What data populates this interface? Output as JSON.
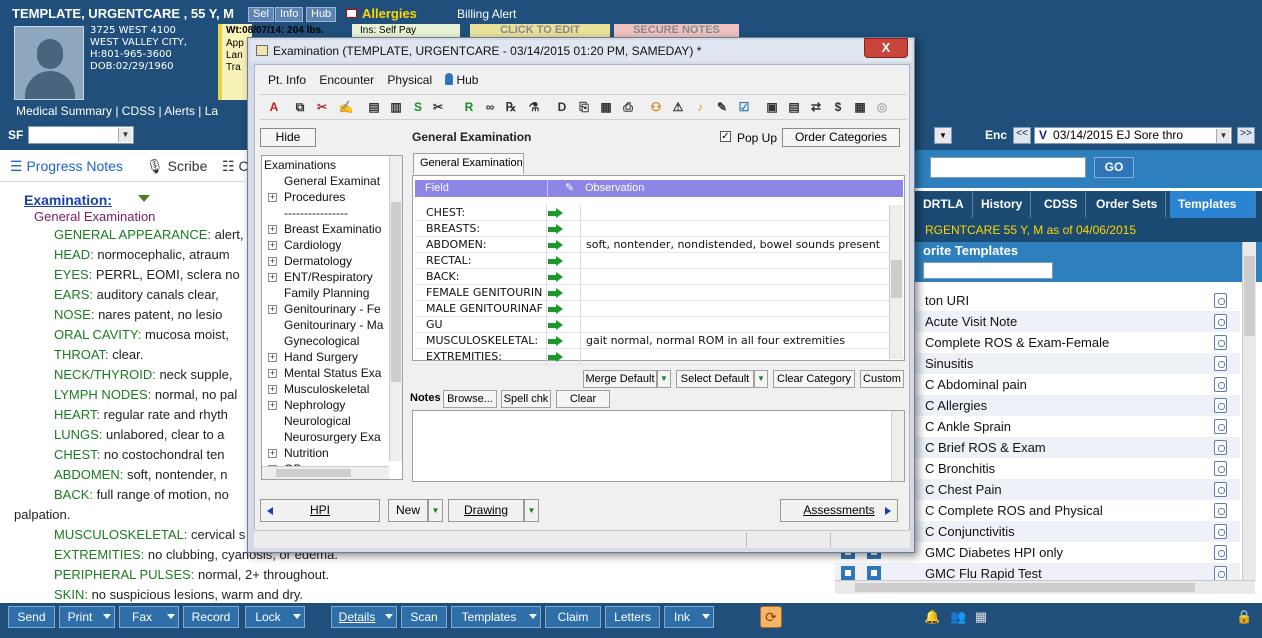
{
  "header": {
    "patient_name": "TEMPLATE, URGENTCARE , 55 Y, M",
    "tags": [
      "Sel",
      "Info",
      "Hub"
    ],
    "allergies": "Allergies",
    "billing_alert": "Billing Alert",
    "address": [
      "3725 WEST 4100",
      "WEST VALLEY CITY,",
      "H:801-965-3600",
      "DOB:02/29/1960"
    ],
    "weight": "Wt:08/07/14: 204 lbs.",
    "weight_overflow": [
      "App",
      "Lan",
      "Tra"
    ],
    "insurance": "Ins:          Self Pay",
    "click_to_edit": "CLICK TO EDIT",
    "secure_notes": "SECURE NOTES",
    "nav_links": "Medical Summary  |  CDSS  |  Alerts  |  La"
  },
  "sfbar": {
    "label": "SF",
    "enc_label": "Enc",
    "enc_prev": "<<",
    "enc_next": ">>",
    "enc_marker": "V",
    "enc_value": "03/14/2015 EJ Sore thro"
  },
  "left": {
    "tabs": [
      "Progress Notes",
      "Scribe",
      "C"
    ],
    "exam_heading": "Examination:",
    "exam_sub": "General Examination",
    "lines": [
      {
        "k": "GENERAL APPEARANCE:",
        "v": " alert,"
      },
      {
        "k": "HEAD:",
        "v": " normocephalic, atraum"
      },
      {
        "k": "EYES:",
        "v": " PERRL, EOMI, sclera no"
      },
      {
        "k": "EARS:",
        "v": " auditory canals clear,"
      },
      {
        "k": "NOSE:",
        "v": " nares patent, no lesio"
      },
      {
        "k": "ORAL CAVITY:",
        "v": " mucosa moist,"
      },
      {
        "k": "THROAT:",
        "v": " clear."
      },
      {
        "k": "NECK/THYROID:",
        "v": " neck supple,"
      },
      {
        "k": "LYMPH NODES:",
        "v": " normal, no pal"
      },
      {
        "k": "HEART:",
        "v": " regular rate and rhyth"
      },
      {
        "k": "LUNGS:",
        "v": " unlabored, clear to a"
      },
      {
        "k": "CHEST:",
        "v": " no costochondral ten"
      },
      {
        "k": "ABDOMEN:",
        "v": " soft, nontender, n"
      },
      {
        "k": "BACK:",
        "v": " full range of motion, no"
      },
      {
        "k": "MUSCULOSKELETAL:",
        "v": " cervical s"
      },
      {
        "k": "EXTREMITIES:",
        "v": " no clubbing, cyanosis, or edema."
      },
      {
        "k": "PERIPHERAL PULSES:",
        "v": " normal, 2+ throughout."
      },
      {
        "k": "SKIN:",
        "v": " no suspicious lesions, warm and dry."
      }
    ],
    "palpation": "palpation."
  },
  "right": {
    "go": "GO",
    "tabs": [
      "DRTLA",
      "History",
      "CDSS",
      "Order Sets",
      "Templates"
    ],
    "info": "RGENTCARE 55 Y, M as of 04/06/2015",
    "fav_title": "orite Templates",
    "templates": [
      "ton URI",
      "Acute Visit Note",
      "Complete ROS & Exam-Female",
      "Sinusitis",
      "C Abdominal pain",
      "C Allergies",
      "C Ankle Sprain",
      "C Brief ROS & Exam",
      "C Bronchitis",
      "C Chest Pain",
      "C Complete ROS and Physical",
      "C Conjunctivitis",
      "GMC Diabetes HPI only",
      "GMC Flu Rapid Test"
    ]
  },
  "dialog": {
    "title": "Examination (TEMPLATE, URGENTCARE  - 03/14/2015  01:20 PM, SAMEDAY) *",
    "close": "X",
    "menu": [
      "Pt. Info",
      "Encounter",
      "Physical",
      "Hub"
    ],
    "hide": "Hide",
    "section_title": "General Examination",
    "popup": "Pop Up",
    "popup_checked": "✓",
    "order_categories": "Order Categories",
    "tree": [
      {
        "t": "Examinations",
        "pm": "",
        "indent": 0
      },
      {
        "t": "General Examinat",
        "pm": "",
        "indent": 1
      },
      {
        "t": "Procedures",
        "pm": "+",
        "indent": 1
      },
      {
        "t": "----------------",
        "pm": "",
        "indent": 1
      },
      {
        "t": "Breast Examinatio",
        "pm": "+",
        "indent": 1
      },
      {
        "t": "Cardiology",
        "pm": "+",
        "indent": 1
      },
      {
        "t": "Dermatology",
        "pm": "+",
        "indent": 1
      },
      {
        "t": "ENT/Respiratory",
        "pm": "+",
        "indent": 1
      },
      {
        "t": "Family Planning",
        "pm": "",
        "indent": 1
      },
      {
        "t": "Genitourinary - Fe",
        "pm": "+",
        "indent": 1
      },
      {
        "t": "Genitourinary - Ma",
        "pm": "",
        "indent": 1
      },
      {
        "t": "Gynecological",
        "pm": "",
        "indent": 1
      },
      {
        "t": "Hand Surgery",
        "pm": "+",
        "indent": 1
      },
      {
        "t": "Mental Status Exa",
        "pm": "+",
        "indent": 1
      },
      {
        "t": "Musculoskeletal",
        "pm": "+",
        "indent": 1
      },
      {
        "t": "Nephrology",
        "pm": "+",
        "indent": 1
      },
      {
        "t": "Neurological",
        "pm": "",
        "indent": 1
      },
      {
        "t": "Neurosurgery Exa",
        "pm": "",
        "indent": 1
      },
      {
        "t": "Nutrition",
        "pm": "+",
        "indent": 1
      },
      {
        "t": "OB",
        "pm": "+",
        "indent": 1
      }
    ],
    "tab": "General Examination",
    "grid_head": {
      "field": "Field",
      "observation": "Observation"
    },
    "rows": [
      {
        "f": "CHEST:",
        "o": ""
      },
      {
        "f": "BREASTS:",
        "o": ""
      },
      {
        "f": "ABDOMEN:",
        "o": "soft, nontender, nondistended, bowel sounds present"
      },
      {
        "f": "RECTAL:",
        "o": ""
      },
      {
        "f": "BACK:",
        "o": ""
      },
      {
        "f": "FEMALE GENITOURIN",
        "o": ""
      },
      {
        "f": "MALE GENITOURINAF",
        "o": ""
      },
      {
        "f": "GU",
        "o": ""
      },
      {
        "f": "MUSCULOSKELETAL:",
        "o": "gait normal, normal ROM in all four extremities"
      },
      {
        "f": "EXTREMITIES:",
        "o": ""
      }
    ],
    "merge_default": "Merge Default",
    "select_default": "Select Default",
    "clear_category": "Clear Category",
    "custom": "Custom",
    "notes_label": "Notes",
    "browse": "Browse...",
    "spell": "Spell chk",
    "clear": "Clear",
    "hpi": "HPI",
    "new": "New",
    "drawing": "Drawing",
    "assessments": "Assessments"
  },
  "bottom": {
    "buttons": [
      "Send",
      "Print",
      "Fax",
      "Record",
      "Lock",
      "Details",
      "Scan",
      "Templates",
      "Claim",
      "Letters",
      "Ink"
    ]
  },
  "colors": {
    "header_bg": "#1f4f7a",
    "accent": "#2b84d1",
    "allergy": "#ffd800",
    "grid_head": "#8d86e6",
    "note_key": "#1b7a22"
  }
}
